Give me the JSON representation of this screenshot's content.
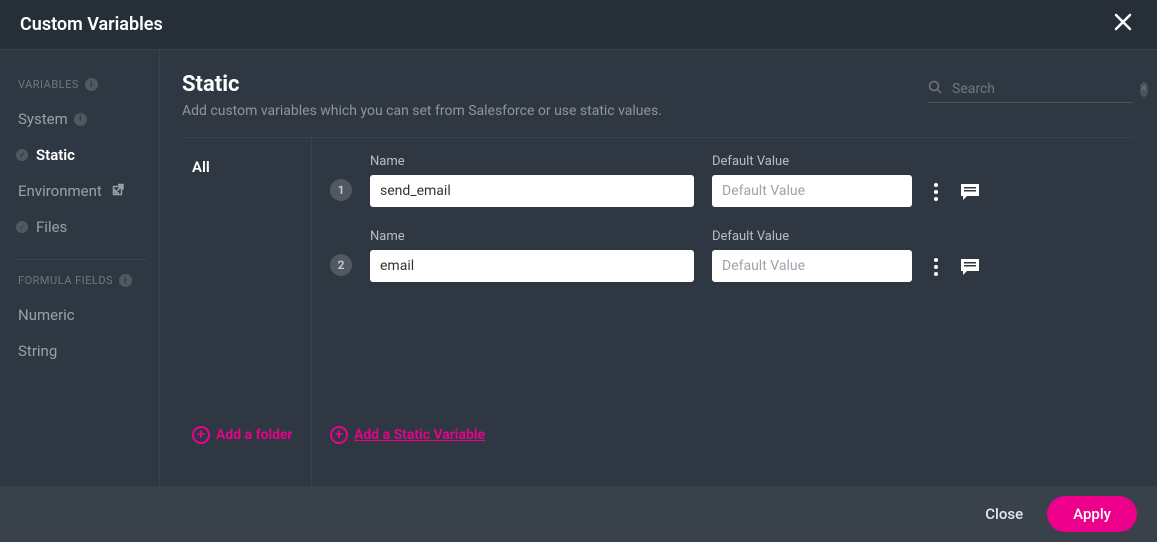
{
  "modal": {
    "title": "Custom Variables"
  },
  "sidebar": {
    "sections": [
      {
        "label": "VARIABLES",
        "has_info": true
      },
      {
        "label": "FORMULA FIELDS",
        "has_info": true
      }
    ],
    "variables_items": [
      {
        "label": "System",
        "has_badge": true
      },
      {
        "label": "Static",
        "active": true,
        "has_check": true
      },
      {
        "label": "Environment",
        "external": true
      },
      {
        "label": "Files",
        "has_check": true
      }
    ],
    "formula_items": [
      {
        "label": "Numeric"
      },
      {
        "label": "String"
      }
    ]
  },
  "main": {
    "title": "Static",
    "subtitle": "Add custom variables which you can set from Salesforce or use static values.",
    "search_placeholder": "Search"
  },
  "folders": {
    "items": [
      "All"
    ],
    "add_label": "Add a folder"
  },
  "variables": {
    "name_label": "Name",
    "default_label": "Default Value",
    "default_placeholder": "Default Value",
    "rows": [
      {
        "num": "1",
        "name": "send_email",
        "default": ""
      },
      {
        "num": "2",
        "name": "email",
        "default": ""
      }
    ],
    "add_label": "Add a Static Variable"
  },
  "footer": {
    "close": "Close",
    "apply": "Apply"
  }
}
